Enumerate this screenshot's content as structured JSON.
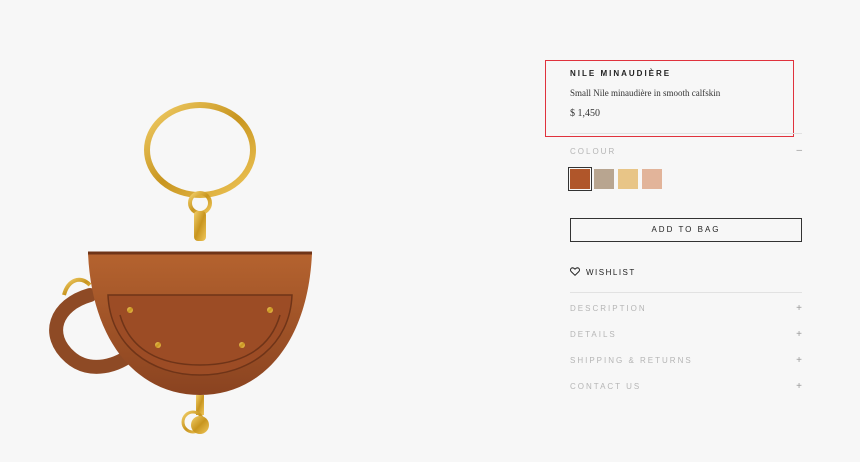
{
  "product": {
    "title": "NILE MINAUDIÈRE",
    "description": "Small Nile minaudière in smooth calfskin",
    "price": "$ 1,450"
  },
  "colour": {
    "label": "COLOUR",
    "toggle": "–",
    "swatches": [
      {
        "color": "#b0562a",
        "selected": true
      },
      {
        "color": "#b8a590",
        "selected": false
      },
      {
        "color": "#e8c587",
        "selected": false
      },
      {
        "color": "#e2b49a",
        "selected": false
      }
    ]
  },
  "add_to_bag": "ADD TO BAG",
  "wishlist": "WISHLIST",
  "accordion": [
    {
      "label": "DESCRIPTION",
      "icon": "+"
    },
    {
      "label": "DETAILS",
      "icon": "+"
    },
    {
      "label": "SHIPPING & RETURNS",
      "icon": "+"
    },
    {
      "label": "CONTACT US",
      "icon": "+"
    }
  ],
  "colors": {
    "highlight": "#e0323d",
    "leather": "#a0522d",
    "gold": "#d9a62e"
  }
}
